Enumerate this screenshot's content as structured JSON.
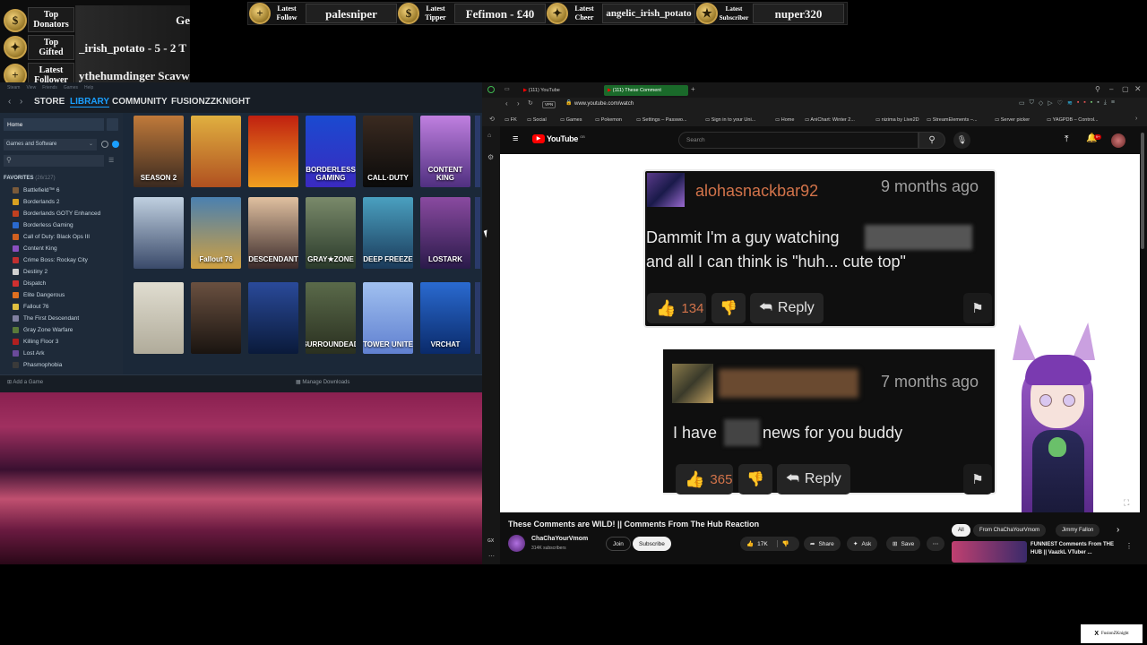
{
  "overlay": {
    "left": [
      {
        "label": "Top\nDonators",
        "value": "Ge"
      },
      {
        "label": "Top\nGifted",
        "value": "_irish_potato - 5     - 2   T"
      },
      {
        "label": "Latest\nFollower",
        "value": "ythehumdinger    Scavwhi"
      }
    ],
    "top": [
      {
        "label": "Latest\nFollow",
        "value": "palesniper"
      },
      {
        "label": "Latest\nTipper",
        "value": "Fefimon - £40"
      },
      {
        "label": "Latest\nCheer",
        "value": "angelic_irish_potato"
      },
      {
        "label": "Latest\nSubscriber",
        "value": "nuper320"
      }
    ],
    "badge_symbol": "$",
    "gold": "#c9a24a"
  },
  "steam": {
    "menu": [
      "Steam",
      "View",
      "Friends",
      "Games",
      "Help"
    ],
    "nav": {
      "store": "STORE",
      "library": "LIBRARY",
      "community": "COMMUNITY",
      "user": "FUSIONZZKNIGHT"
    },
    "home": "Home",
    "filter": "Games and Software",
    "favorites": "FAVORITES",
    "favorites_count": "(26/127)",
    "games": [
      {
        "name": "Battlefield™ 6",
        "color": "#7a5a3a"
      },
      {
        "name": "Borderlands 2",
        "color": "#d8a020"
      },
      {
        "name": "Borderlands GOTY Enhanced",
        "color": "#c04020"
      },
      {
        "name": "Borderless Gaming",
        "color": "#2a6ad0"
      },
      {
        "name": "Call of Duty: Black Ops III",
        "color": "#d06020"
      },
      {
        "name": "Content King",
        "color": "#8a50c0"
      },
      {
        "name": "Crime Boss: Rockay City",
        "color": "#c03030"
      },
      {
        "name": "Destiny 2",
        "color": "#d0d0d0"
      },
      {
        "name": "Dispatch",
        "color": "#d03030"
      },
      {
        "name": "Elite Dangerous",
        "color": "#e07020"
      },
      {
        "name": "Fallout 76",
        "color": "#e0c040"
      },
      {
        "name": "The First Descendant",
        "color": "#8080a0"
      },
      {
        "name": "Gray Zone Warfare",
        "color": "#5a7a3a"
      },
      {
        "name": "Killing Floor 3",
        "color": "#b02020"
      },
      {
        "name": "Lost Ark",
        "color": "#6a4a9a"
      },
      {
        "name": "Phasmophobia",
        "color": "#3a3a3a"
      }
    ],
    "add_game": "Add a Game",
    "manage_downloads": "Manage Downloads",
    "tiles": [
      {
        "label": "SEASON 2",
        "bg": "linear-gradient(#c07a3a,#3a2a20)"
      },
      {
        "label": "",
        "bg": "linear-gradient(#e0b040,#b05020)"
      },
      {
        "label": "",
        "bg": "linear-gradient(#c02010,#f0a020)"
      },
      {
        "label": "BORDERLESS GAMING",
        "bg": "linear-gradient(#1a4ad0,#3a2ac0)"
      },
      {
        "label": "CALL·DUTY",
        "bg": "linear-gradient(#3a2a20,#0a0a0a)"
      },
      {
        "label": "CONTENT KING",
        "bg": "linear-gradient(#c080e0,#503080)"
      },
      {
        "label": "",
        "bg": "linear-gradient(#c0d0e0,#3a4a6a)"
      },
      {
        "label": "Fallout 76",
        "bg": "linear-gradient(#4a80b0,#d0a040)"
      },
      {
        "label": "DESCENDANT",
        "bg": "linear-gradient(#e0c0a0,#3a2a2a)"
      },
      {
        "label": "GRAY★ZONE",
        "bg": "linear-gradient(#7a8a6a,#2a3a2a)"
      },
      {
        "label": "DEEP FREEZE",
        "bg": "linear-gradient(#4aa0c0,#1a3a5a)"
      },
      {
        "label": "LOSTARK",
        "bg": "linear-gradient(#8a4aa0,#2a1a4a)"
      },
      {
        "label": "",
        "bg": "linear-gradient(#e0ddd0,#b0ab9a)"
      },
      {
        "label": "",
        "bg": "linear-gradient(#6a5040,#1a1410)"
      },
      {
        "label": "",
        "bg": "linear-gradient(#2a4a9a,#0a1a3a)"
      },
      {
        "label": "SURROUNDEAD",
        "bg": "linear-gradient(#5a6a4a,#2a3020)"
      },
      {
        "label": "TOWER UNITE",
        "bg": "linear-gradient(#a0c0f0,#6080d0)"
      },
      {
        "label": "VRCHAT",
        "bg": "linear-gradient(#2a6ad0,#0a2a6a)"
      }
    ]
  },
  "browser": {
    "tabs": [
      {
        "label": "(111) YouTube"
      },
      {
        "label": "(111) These Comment"
      }
    ],
    "url": "www.youtube.com/watch",
    "vpn": "VPN",
    "bookmarks": [
      "FK",
      "Social",
      "Games",
      "Pokemon",
      "Settings – Passwo...",
      "Sign in to your Uni...",
      "Home",
      "AniChart: Winter 2...",
      "nizima by Live2D",
      "StreamElements –...",
      "Server picker",
      "YAGPDB – Control..."
    ],
    "search_placeholder": "Search",
    "yt_logo": "YouTube",
    "yt_country": "GB"
  },
  "video": {
    "title": "These Comments are WILD! || Comments From The Hub Reaction",
    "channel": "ChaChaYourVmom",
    "subscribers": "314K subscribers",
    "join": "Join",
    "subscribe": "Subscribe",
    "likes": "17K",
    "share": "Share",
    "ask": "Ask",
    "save": "Save",
    "chips": [
      "All",
      "From ChaChaYourVmom",
      "Jimmy Fallon"
    ],
    "rec_title": "FUNNIEST Comments From THE HUB || VaazkL VTuber ...",
    "comments": [
      {
        "user": "alohasnackbar92",
        "time": "9 months ago",
        "text1": "Dammit I'm a guy watching",
        "text2": "and all I can think is \"huh... cute top\"",
        "likes": "134",
        "reply": "Reply"
      },
      {
        "user": "",
        "time": "7 months ago",
        "text1": "I have",
        "text2": "news for you buddy",
        "likes": "365",
        "reply": "Reply"
      }
    ]
  },
  "footer": {
    "handle": "FusionZKnight",
    "x_mark": "X"
  }
}
